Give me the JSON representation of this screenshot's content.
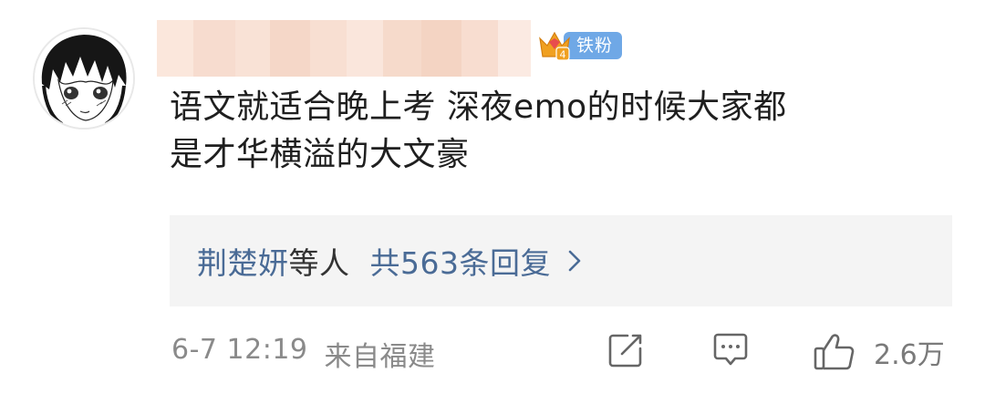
{
  "post": {
    "fan_badge": "铁粉",
    "fan_level": "4",
    "text_line1": "语文就适合晚上考 深夜emo的时候大家都",
    "text_line2": "是才华横溢的大文豪"
  },
  "replies": {
    "names": "荆楚妍",
    "suffix": "等人",
    "count_label": "共563条回复"
  },
  "footer": {
    "time": "6-7 12:19",
    "location": "来自福建",
    "like_count": "2.6万"
  },
  "icons": {
    "repost": "repost-icon",
    "comment": "comment-icon",
    "like": "thumbs-up-icon",
    "chevron": "chevron-right-icon",
    "crown": "crown-icon"
  },
  "colors": {
    "link_blue": "#4a6b96",
    "badge_blue": "#6fa8e6",
    "crown_gold": "#f0a020",
    "meta_gray": "#8a8a8a"
  }
}
